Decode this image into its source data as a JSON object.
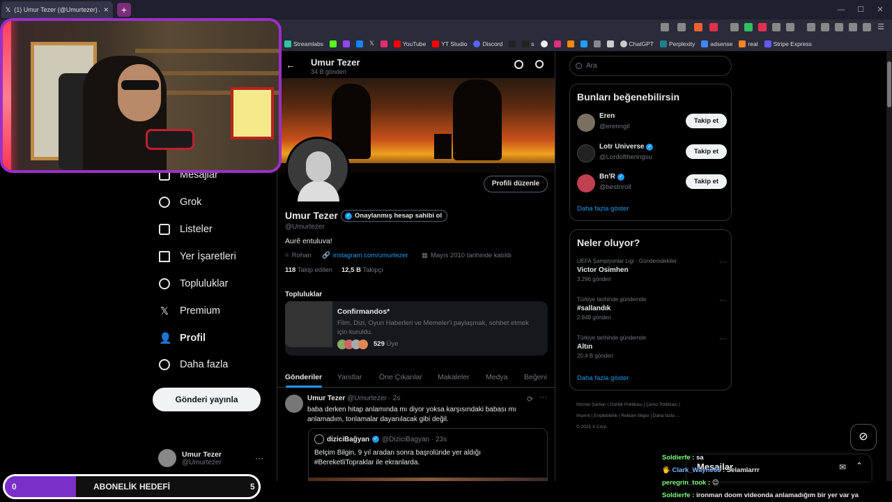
{
  "browser": {
    "tab_title": "(1) Umur Tezer (@Umurtezer) / X",
    "bookmarks": [
      "Streamlabs",
      "YouTube",
      "YT Studio",
      "Discord",
      "s",
      "ChatGPT",
      "Perplexity",
      "adsense",
      "real",
      "Stripe Express"
    ],
    "accent": "#9b2fc9"
  },
  "nav": {
    "items": [
      "Mesajlar",
      "Grok",
      "Listeler",
      "Yer İşaretleri",
      "Topluluklar",
      "Premium",
      "Profil",
      "Daha fazla"
    ],
    "post_button": "Gönderi yayınla",
    "account_name": "Umur Tezer",
    "account_handle": "@Umurtezer",
    "account_more": "···"
  },
  "profile": {
    "name": "Umur Tezer",
    "posts_count": "34 B gönderi",
    "edit_button": "Profili düzenle",
    "verified_label": "Onaylanmış hesap sahibi ol",
    "handle": "@Umurtezer",
    "bio": "Aurê entuluva!",
    "location": "Rohan",
    "link": "instagram.com/umurtezer",
    "joined": "Mayıs 2010 tarihinde katıldı",
    "following_count": "118",
    "following_label": "Takip edilen",
    "followers_count": "12,5 B",
    "followers_label": "Takipçi",
    "communities_heading": "Topluluklar",
    "community_name": "Confirmandos*",
    "community_desc": "Film, Dizi, Oyun Haberleri ve Memeler'i paylaşmak, sohbet etmek için kuruldu.",
    "community_members": "529",
    "community_members_label": "Üye",
    "tabs": [
      "Gönderiler",
      "Yanıtlar",
      "Öne Çıkanlar",
      "Makaleler",
      "Medya",
      "Beğeni"
    ]
  },
  "tweet": {
    "author": "Umur Tezer",
    "handle": "@Umurtezer · 2s",
    "text": "baba derken hitap anlamında mı diyor yoksa karşısındaki babası mı anlamadım, tonlamalar dayanılacak gibi değil.",
    "quote_author": "diziciBağyan",
    "quote_handle": "@DiziciBagyan · 23s",
    "quote_text": "Belçim Bilgin, 9 yıl aradan sonra başrolünde yer aldığı #BereketliTopraklar ile ekranlarda."
  },
  "sidebar": {
    "search_placeholder": "Ara",
    "suggest_heading": "Bunları beğenebilirsin",
    "suggestions": [
      {
        "name": "Eren",
        "handle": "@erenngil",
        "button": "Takip et"
      },
      {
        "name": "Lotr Universe",
        "handle": "@Lordoftheringsu",
        "button": "Takip et"
      },
      {
        "name": "Bn'R",
        "handle": "@bestnroll",
        "button": "Takip et"
      }
    ],
    "show_more": "Daha fazla göster",
    "trends_heading": "Neler oluyor?",
    "trends": [
      {
        "context": "UEFA Şampiyonlar Ligi · Gündemdekiler",
        "title": "Victor Osimhen",
        "posts": "3.296 gönderi"
      },
      {
        "context": "Türkiye tarihinde gündemde",
        "title": "#sallandık",
        "posts": "2.848 gönderi"
      },
      {
        "context": "Türkiye tarihinde gündemde",
        "title": "Altın",
        "posts": "20,4 B gönderi"
      }
    ],
    "trends_more": "Daha fazla göster",
    "footer_row1": "Hizmet Şartları  |  Gizlilik Politikası  |  Çerez Politikası  |",
    "footer_row2": "Imprint  |  Erişilebilirlik  |  Reklam bilgisi  |  Daha fazla ...",
    "footer_row3": "© 2025 X Corp."
  },
  "messages": {
    "title": "Mesajlar"
  },
  "chat": [
    {
      "user": "Soldierfe",
      "text": ": sa"
    },
    {
      "user": "Clark_Wayne66",
      "text": ": Selamlarrr"
    },
    {
      "user": "peregrin_took",
      "text": ":"
    },
    {
      "user": "Soldierfe",
      "text": ": ironman doom videonda anlamadığım bir yer var ya"
    }
  ],
  "sub_goal": {
    "label": "ABONELİK HEDEFİ",
    "current": "0",
    "target": "5",
    "progress": 0.04
  }
}
